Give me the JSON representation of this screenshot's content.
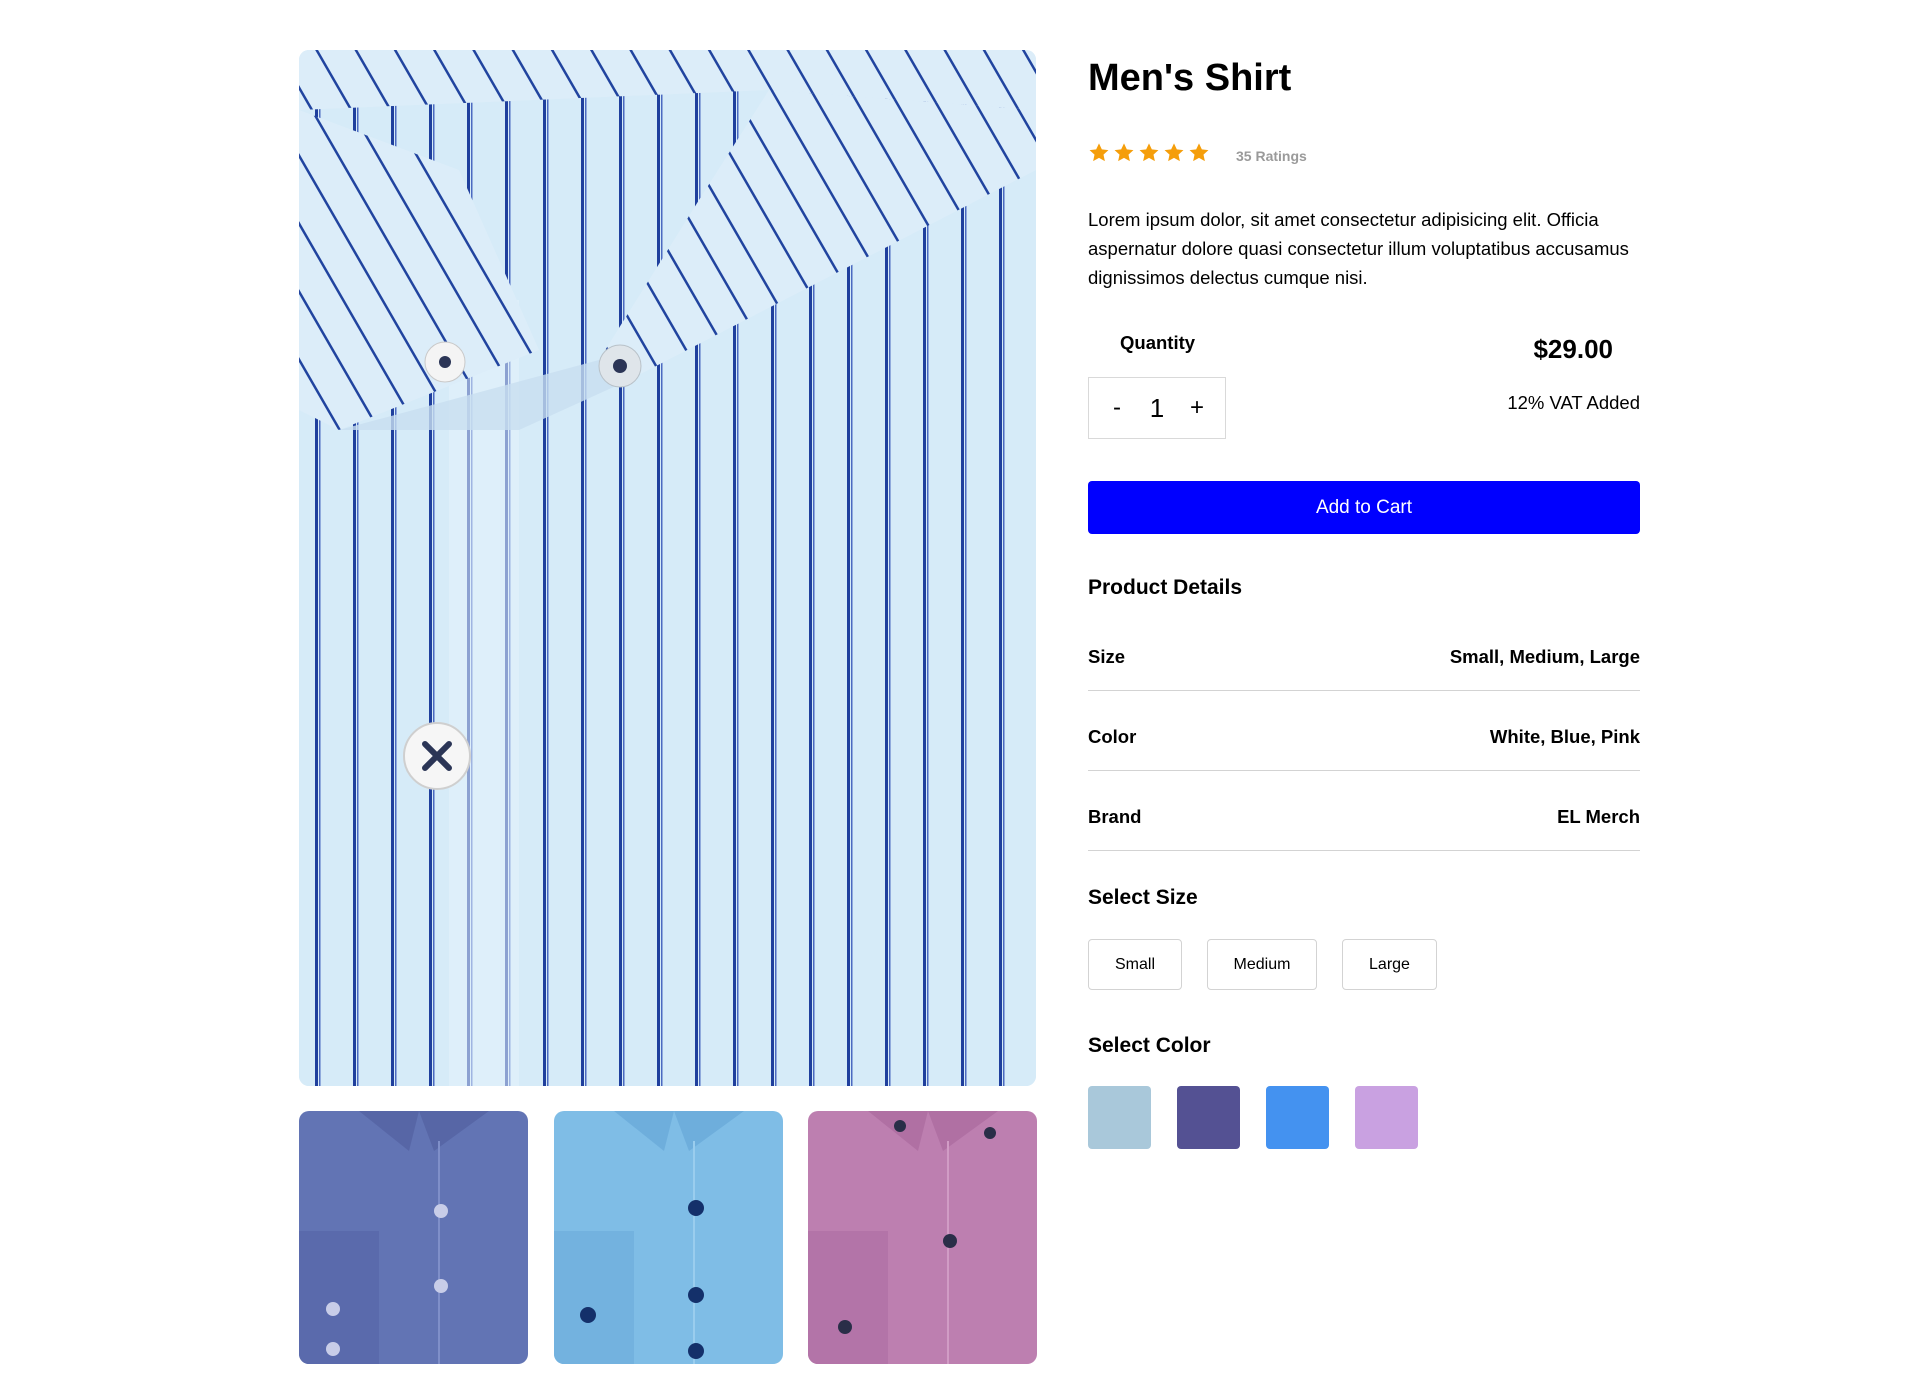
{
  "product": {
    "title": "Men's Shirt",
    "rating": {
      "stars": 5,
      "label": "35 Ratings"
    },
    "description": "Lorem ipsum dolor, sit amet consectetur adipisicing elit. Officia aspernatur dolore quasi consectetur illum voluptatibus accusamus dignissimos delectus cumque nisi.",
    "quantity": {
      "label": "Quantity",
      "decrement": "-",
      "value": "1",
      "increment": "+"
    },
    "price": "$29.00",
    "vat_note": "12% VAT Added",
    "add_to_cart": "Add to Cart"
  },
  "gallery": {
    "main_image": "striped-light-blue-shirt",
    "thumbnails": [
      {
        "name": "navy-shirt",
        "color": "#6274b4"
      },
      {
        "name": "sky-blue-shirt",
        "color": "#7fbde6"
      },
      {
        "name": "pink-shirt",
        "color": "#bd7fb0"
      }
    ]
  },
  "details": {
    "heading": "Product Details",
    "rows": [
      {
        "label": "Size",
        "value": "Small, Medium, Large"
      },
      {
        "label": "Color",
        "value": "White, Blue, Pink"
      },
      {
        "label": "Brand",
        "value": "EL Merch"
      }
    ]
  },
  "select_size": {
    "heading": "Select Size",
    "options": [
      "Small",
      "Medium",
      "Large"
    ]
  },
  "select_color": {
    "heading": "Select Color",
    "swatches": [
      "#a9c8da",
      "#545193",
      "#4492f0",
      "#c9a1e1"
    ]
  },
  "colors": {
    "accent": "#0000ff",
    "star": "#f59e0b",
    "muted_text": "#9a9a9a",
    "divider": "#d3d3d3"
  }
}
